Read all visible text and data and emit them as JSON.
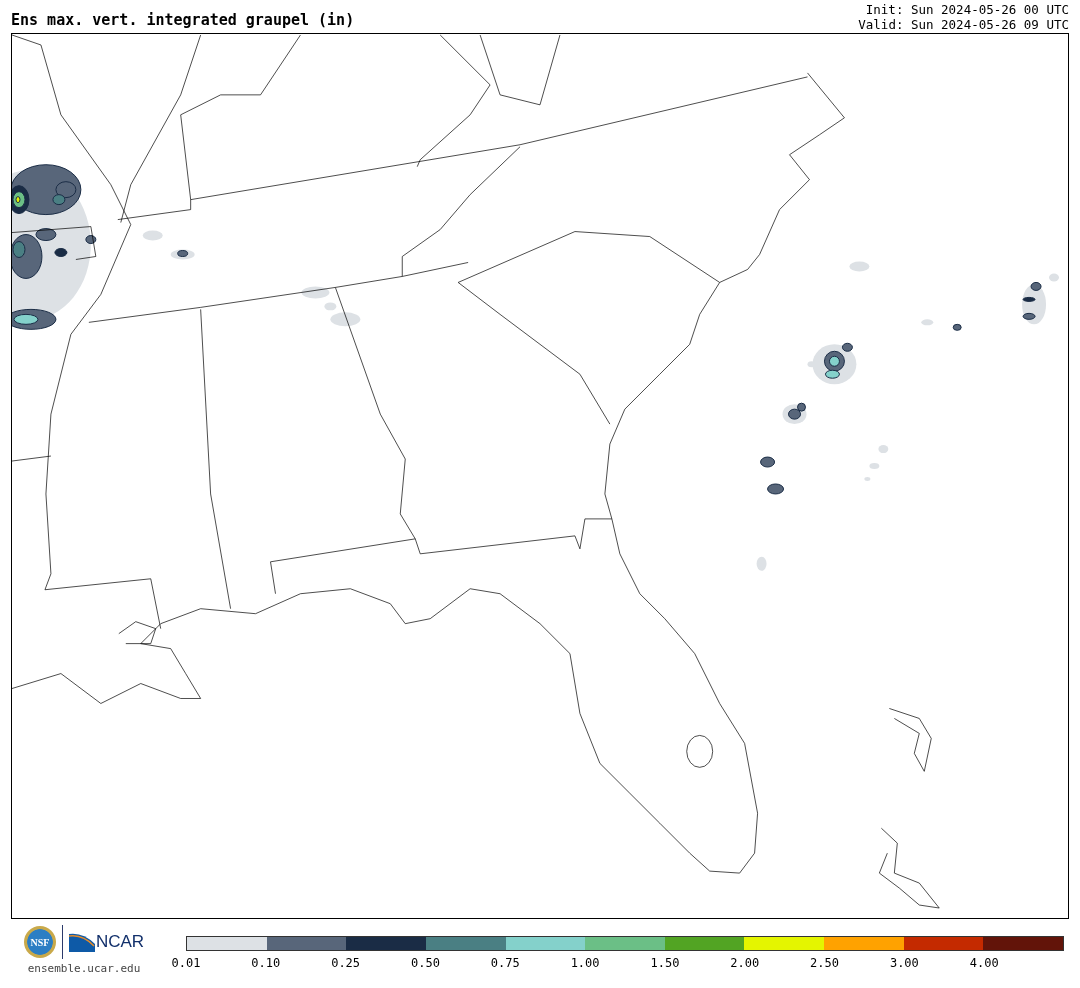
{
  "header": {
    "title": "Ens max. vert. integrated graupel (in)",
    "init": "Init: Sun 2024-05-26 00 UTC",
    "valid": "Valid: Sun 2024-05-26 09 UTC"
  },
  "footer": {
    "nsf_logo_text": "NSF",
    "ncar_logo_text": "NCAR",
    "url": "ensemble.ucar.edu"
  },
  "colorbar": {
    "bins": [
      {
        "color": "#dde1e5"
      },
      {
        "color": "#58667a"
      },
      {
        "color": "#1a2c45"
      },
      {
        "color": "#4a7f83"
      },
      {
        "color": "#84d1cb"
      },
      {
        "color": "#6bbf86"
      },
      {
        "color": "#52a423"
      },
      {
        "color": "#e4f500"
      },
      {
        "color": "#ffa200"
      },
      {
        "color": "#c42a00"
      },
      {
        "color": "#621409"
      }
    ],
    "ticks": [
      "0.01",
      "0.10",
      "0.25",
      "0.50",
      "0.75",
      "1.00",
      "1.50",
      "2.00",
      "2.50",
      "3.00",
      "4.00"
    ]
  }
}
